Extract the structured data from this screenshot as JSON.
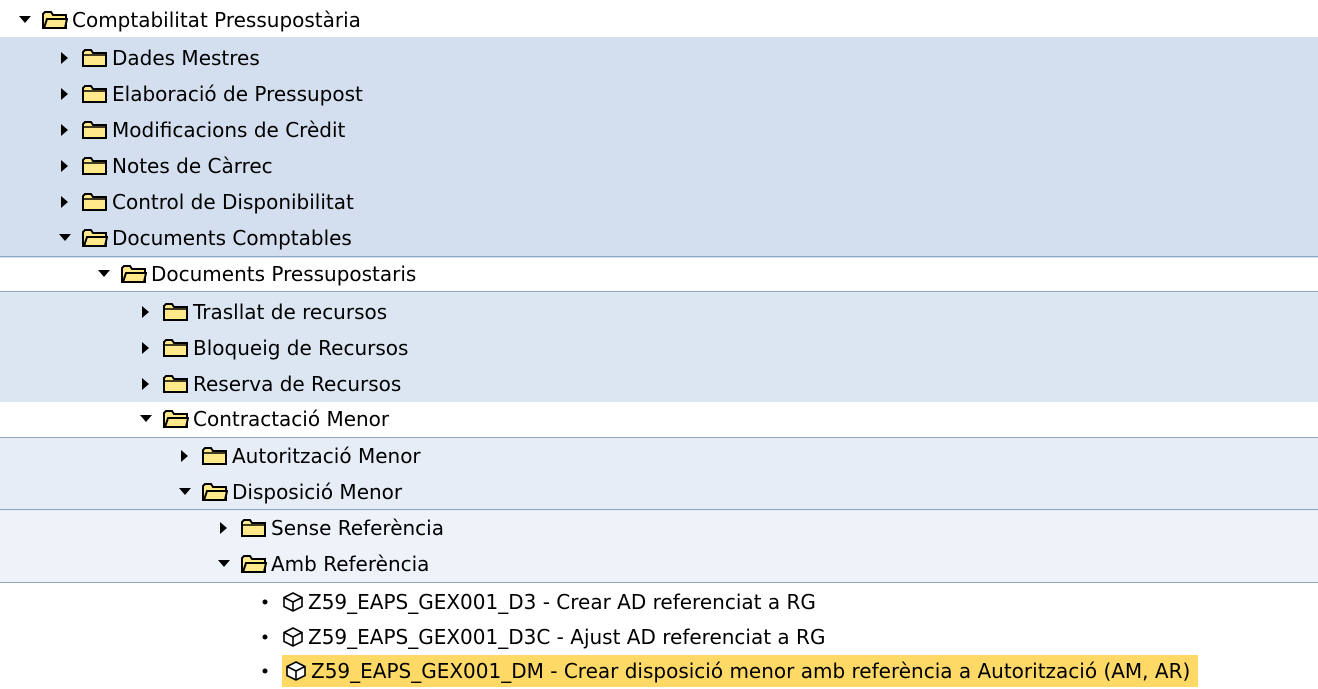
{
  "tree": {
    "root": {
      "label": "Comptabilitat Pressupostària",
      "expanded": true
    },
    "level1": [
      {
        "label": "Dades Mestres",
        "expanded": false
      },
      {
        "label": "Elaboració de Pressupost",
        "expanded": false
      },
      {
        "label": "Modificacions de Crèdit",
        "expanded": false
      },
      {
        "label": "Notes de Càrrec",
        "expanded": false
      },
      {
        "label": "Control de Disponibilitat",
        "expanded": false
      },
      {
        "label": "Documents Comptables",
        "expanded": true
      }
    ],
    "level2": [
      {
        "label": "Documents Pressupostaris",
        "expanded": true
      }
    ],
    "level3": [
      {
        "label": "Trasllat de recursos",
        "expanded": false
      },
      {
        "label": "Bloqueig de Recursos",
        "expanded": false
      },
      {
        "label": "Reserva de Recursos",
        "expanded": false
      },
      {
        "label": "Contractació Menor",
        "expanded": true
      }
    ],
    "level4": [
      {
        "label": "Autorització Menor",
        "expanded": false
      },
      {
        "label": "Disposició Menor",
        "expanded": true
      }
    ],
    "level5": [
      {
        "label": "Sense Referència",
        "expanded": false
      },
      {
        "label": "Amb Referència",
        "expanded": true
      }
    ],
    "transactions": [
      {
        "label": "Z59_EAPS_GEX001_D3 - Crear AD referenciat a RG",
        "selected": false
      },
      {
        "label": "Z59_EAPS_GEX001_D3C - Ajust AD referenciat a RG",
        "selected": false
      },
      {
        "label": "Z59_EAPS_GEX001_DM - Crear disposició menor amb referència a Autorització (AM, AR)",
        "selected": true
      }
    ]
  },
  "colors": {
    "level1_bg": "#d3dfee",
    "level3_bg": "#dce6f2",
    "level4_bg": "#e6edf6",
    "level5_bg": "#eef3f9",
    "selected_bg": "#ffd966",
    "folder_fill": "#ffe98a",
    "folder_stroke": "#000000"
  },
  "icons": {
    "collapsed": "triangle-right-icon",
    "expanded": "triangle-down-icon",
    "folder_closed": "folder-icon",
    "folder_open": "folder-open-icon",
    "transaction": "transaction-cube-icon",
    "bullet": "bullet-icon"
  }
}
